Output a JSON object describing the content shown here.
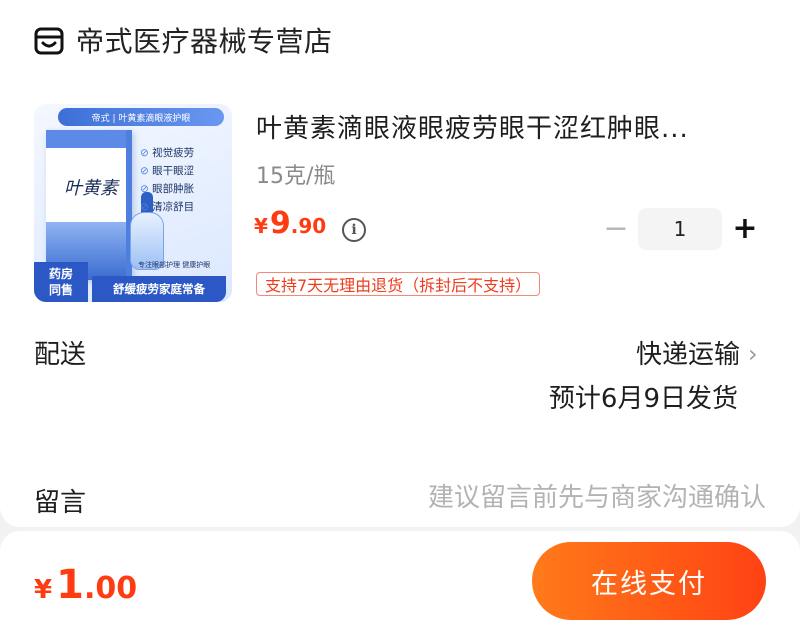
{
  "shop": {
    "name": "帝式医疗器械专营店",
    "icon": "store-icon"
  },
  "product": {
    "title": "叶黄素滴眼液眼疲劳眼干涩红肿眼...",
    "spec": "15克/瓶",
    "price": {
      "currency": "¥",
      "integer": "9",
      "decimal": ".90"
    },
    "quantity": "1",
    "minus_label": "−",
    "plus_label": "+",
    "return_policy": "支持7天无理由退货（拆封后不支持）",
    "image": {
      "header": "帝式 | 叶黄素滴眼液护眼",
      "box_title": "叶黄素",
      "features": [
        "视觉疲劳",
        "眼干眼涩",
        "眼部肿胀",
        "清凉舒目"
      ],
      "small_text": "专注眼部护理 健康护眼",
      "badge_line1": "药房",
      "badge_line2": "同售",
      "banner": "舒缓疲劳家庭常备"
    }
  },
  "delivery": {
    "label": "配送",
    "method": "快递运输",
    "ship_date": "预计6月9日发货"
  },
  "note": {
    "label": "留言",
    "placeholder": "建议留言前先与商家沟通确认"
  },
  "footer": {
    "total": {
      "currency": "¥",
      "integer": "1",
      "decimal": ".00"
    },
    "pay_label": "在线支付"
  },
  "colors": {
    "accent": "#ff3b12",
    "pay_gradient_start": "#ff7a1a",
    "pay_gradient_end": "#ff4213"
  }
}
